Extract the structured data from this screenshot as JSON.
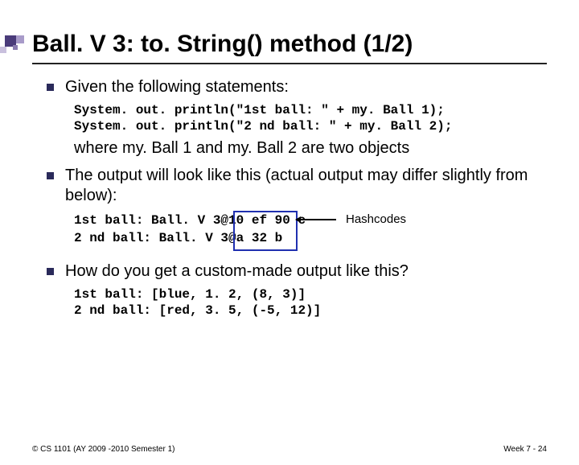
{
  "title": "Ball. V 3: to. String() method (1/2)",
  "bullets": {
    "b1": "Given the following statements:",
    "code1": "System. out. println(\"1st ball: \" + my. Ball 1);\nSystem. out. println(\"2 nd ball: \" + my. Ball 2);",
    "cont1": "where my. Ball 1 and my. Ball 2 are two objects",
    "b2": "The output will look like this (actual output may differ slightly from below):",
    "hc_line1_pre": "1st ball: Ball. V 3@",
    "hc_line1_code": "10 ef 90 c",
    "hc_line2_pre": "2 nd ball: Ball. V 3@",
    "hc_line2_code": "a 32 b",
    "hc_label": "Hashcodes",
    "b3": "How do you get a custom-made output like this?",
    "code3": "1st ball: [blue, 1. 2, (8, 3)]\n2 nd ball: [red, 3. 5, (-5, 12)]"
  },
  "footer": {
    "left": "© CS 1101 (AY 2009 -2010 Semester 1)",
    "right": "Week 7 - 24"
  }
}
